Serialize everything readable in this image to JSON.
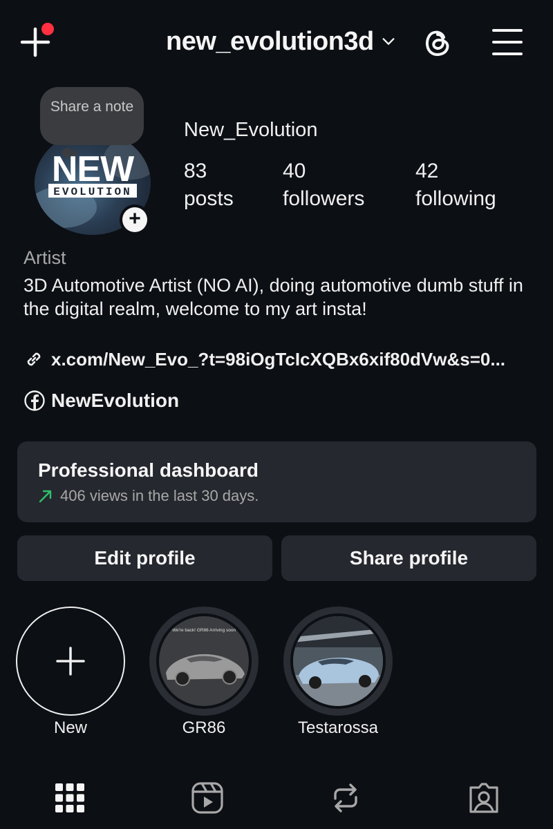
{
  "header": {
    "username": "new_evolution3d",
    "has_notification": true,
    "accent": "#ff3040"
  },
  "profile": {
    "note": "Share a note",
    "display_name": "New_Evolution",
    "avatar_text_top": "NEW",
    "avatar_text_bottom": "EVOLUTION",
    "stats": [
      {
        "value": "83",
        "label": "posts"
      },
      {
        "value": "40",
        "label": "followers"
      },
      {
        "value": "42",
        "label": "following"
      }
    ],
    "category": "Artist",
    "bio": "3D Automotive Artist (NO AI), doing automotive dumb stuff in the digital realm, welcome to my art insta!",
    "link": "x.com/New_Evo_?t=98iOgTcIcXQBx6xif80dVw&s=0...",
    "facebook": "NewEvolution"
  },
  "dashboard": {
    "title": "Professional dashboard",
    "subtitle": "406 views in the last 30 days.",
    "trend_color": "#2ec26a"
  },
  "actions": {
    "edit": "Edit profile",
    "share": "Share profile"
  },
  "highlights": [
    {
      "label": "New"
    },
    {
      "label": "GR86",
      "caption": "We're back! GR86 Arriving soon"
    },
    {
      "label": "Testarossa"
    }
  ],
  "tabs": [
    "grid-icon",
    "reels-icon",
    "reposts-icon",
    "tagged-icon"
  ]
}
